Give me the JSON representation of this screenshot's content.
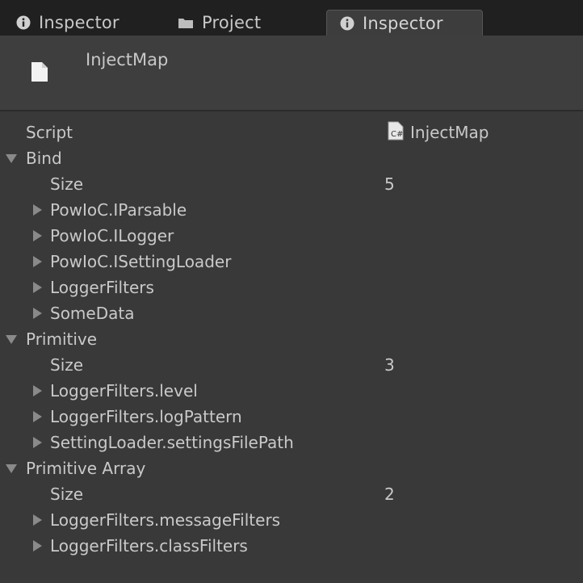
{
  "tabs": [
    {
      "label": "Inspector",
      "icon": "info-icon",
      "active": false
    },
    {
      "label": "Project",
      "icon": "folder-icon",
      "active": false
    },
    {
      "label": "Inspector",
      "icon": "info-icon",
      "active": true
    }
  ],
  "header": {
    "title": "InjectMap",
    "icon": "file-icon"
  },
  "script": {
    "label": "Script",
    "value": "InjectMap",
    "icon": "csharp-script-icon"
  },
  "groups": {
    "bind": {
      "label": "Bind",
      "expanded": true,
      "size_label": "Size",
      "size_value": "5",
      "items": [
        "PowIoC.IParsable",
        "PowIoC.ILogger",
        "PowIoC.ISettingLoader",
        "LoggerFilters",
        "SomeData"
      ]
    },
    "primitive": {
      "label": "Primitive",
      "expanded": true,
      "size_label": "Size",
      "size_value": "3",
      "items": [
        "LoggerFilters.level",
        "LoggerFilters.logPattern",
        "SettingLoader.settingsFilePath"
      ]
    },
    "primitive_array": {
      "label": "Primitive Array",
      "expanded": true,
      "size_label": "Size",
      "size_value": "2",
      "items": [
        "LoggerFilters.messageFilters",
        "LoggerFilters.classFilters"
      ]
    }
  },
  "colors": {
    "background": "#393939",
    "tabbar": "#202020",
    "text": "#c9c9c9",
    "foldout_arrow": "#8a8a8a"
  }
}
